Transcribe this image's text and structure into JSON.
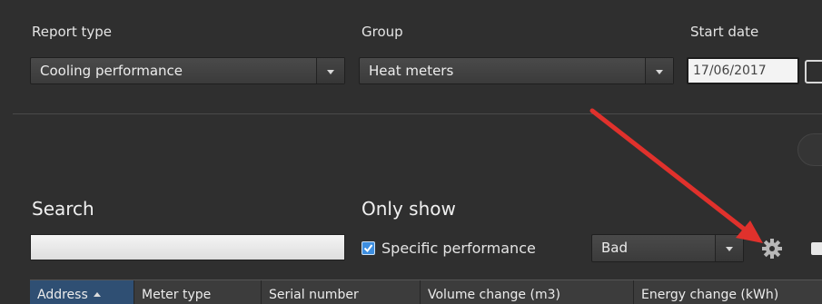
{
  "filters": {
    "report_type_label": "Report type",
    "report_type_value": "Cooling performance",
    "group_label": "Group",
    "group_value": "Heat meters",
    "start_date_label": "Start date",
    "start_date_value": "17/06/2017"
  },
  "search": {
    "label": "Search",
    "value": ""
  },
  "only_show": {
    "label": "Only show",
    "specific_performance_label": "Specific performance",
    "specific_performance_checked": true,
    "performance_value": "Bad"
  },
  "table": {
    "columns": [
      "Address",
      "Meter type",
      "Serial number",
      "Volume change (m3)",
      "Energy change (kWh)"
    ],
    "sorted_column": "Address"
  },
  "icons": {
    "settings": "gear-icon",
    "annotation": "red-arrow"
  },
  "colors": {
    "background": "#2f2f2f",
    "accent": "#3d8ee0",
    "annotation_arrow": "#e0312c"
  }
}
